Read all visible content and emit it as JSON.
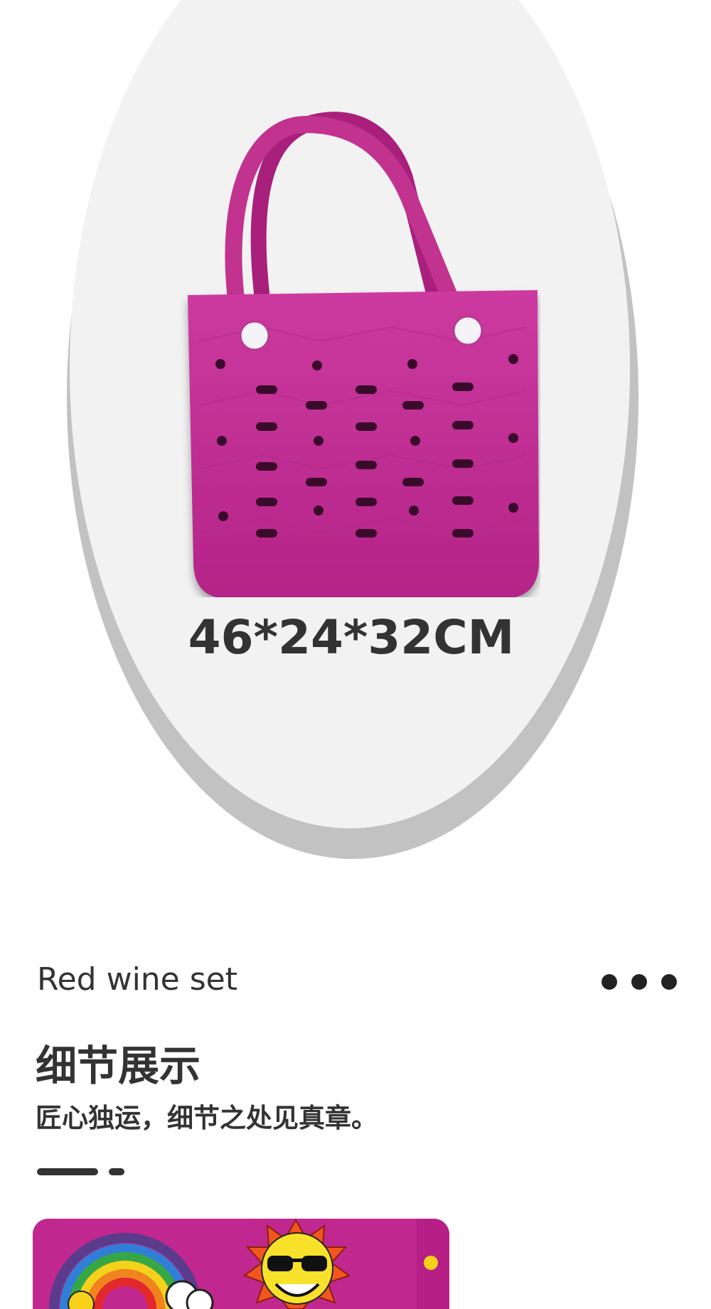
{
  "hero": {
    "dimensions": "46*24*32CM",
    "bag_color": "#c8339a"
  },
  "section": {
    "subtitle": "Red wine set",
    "title": "细节展示",
    "description": "匠心独运，细节之处见真章。",
    "more_icon": "more-dots-icon"
  },
  "detail_image": {
    "charms": [
      "rainbow",
      "sun-with-sunglasses"
    ]
  }
}
